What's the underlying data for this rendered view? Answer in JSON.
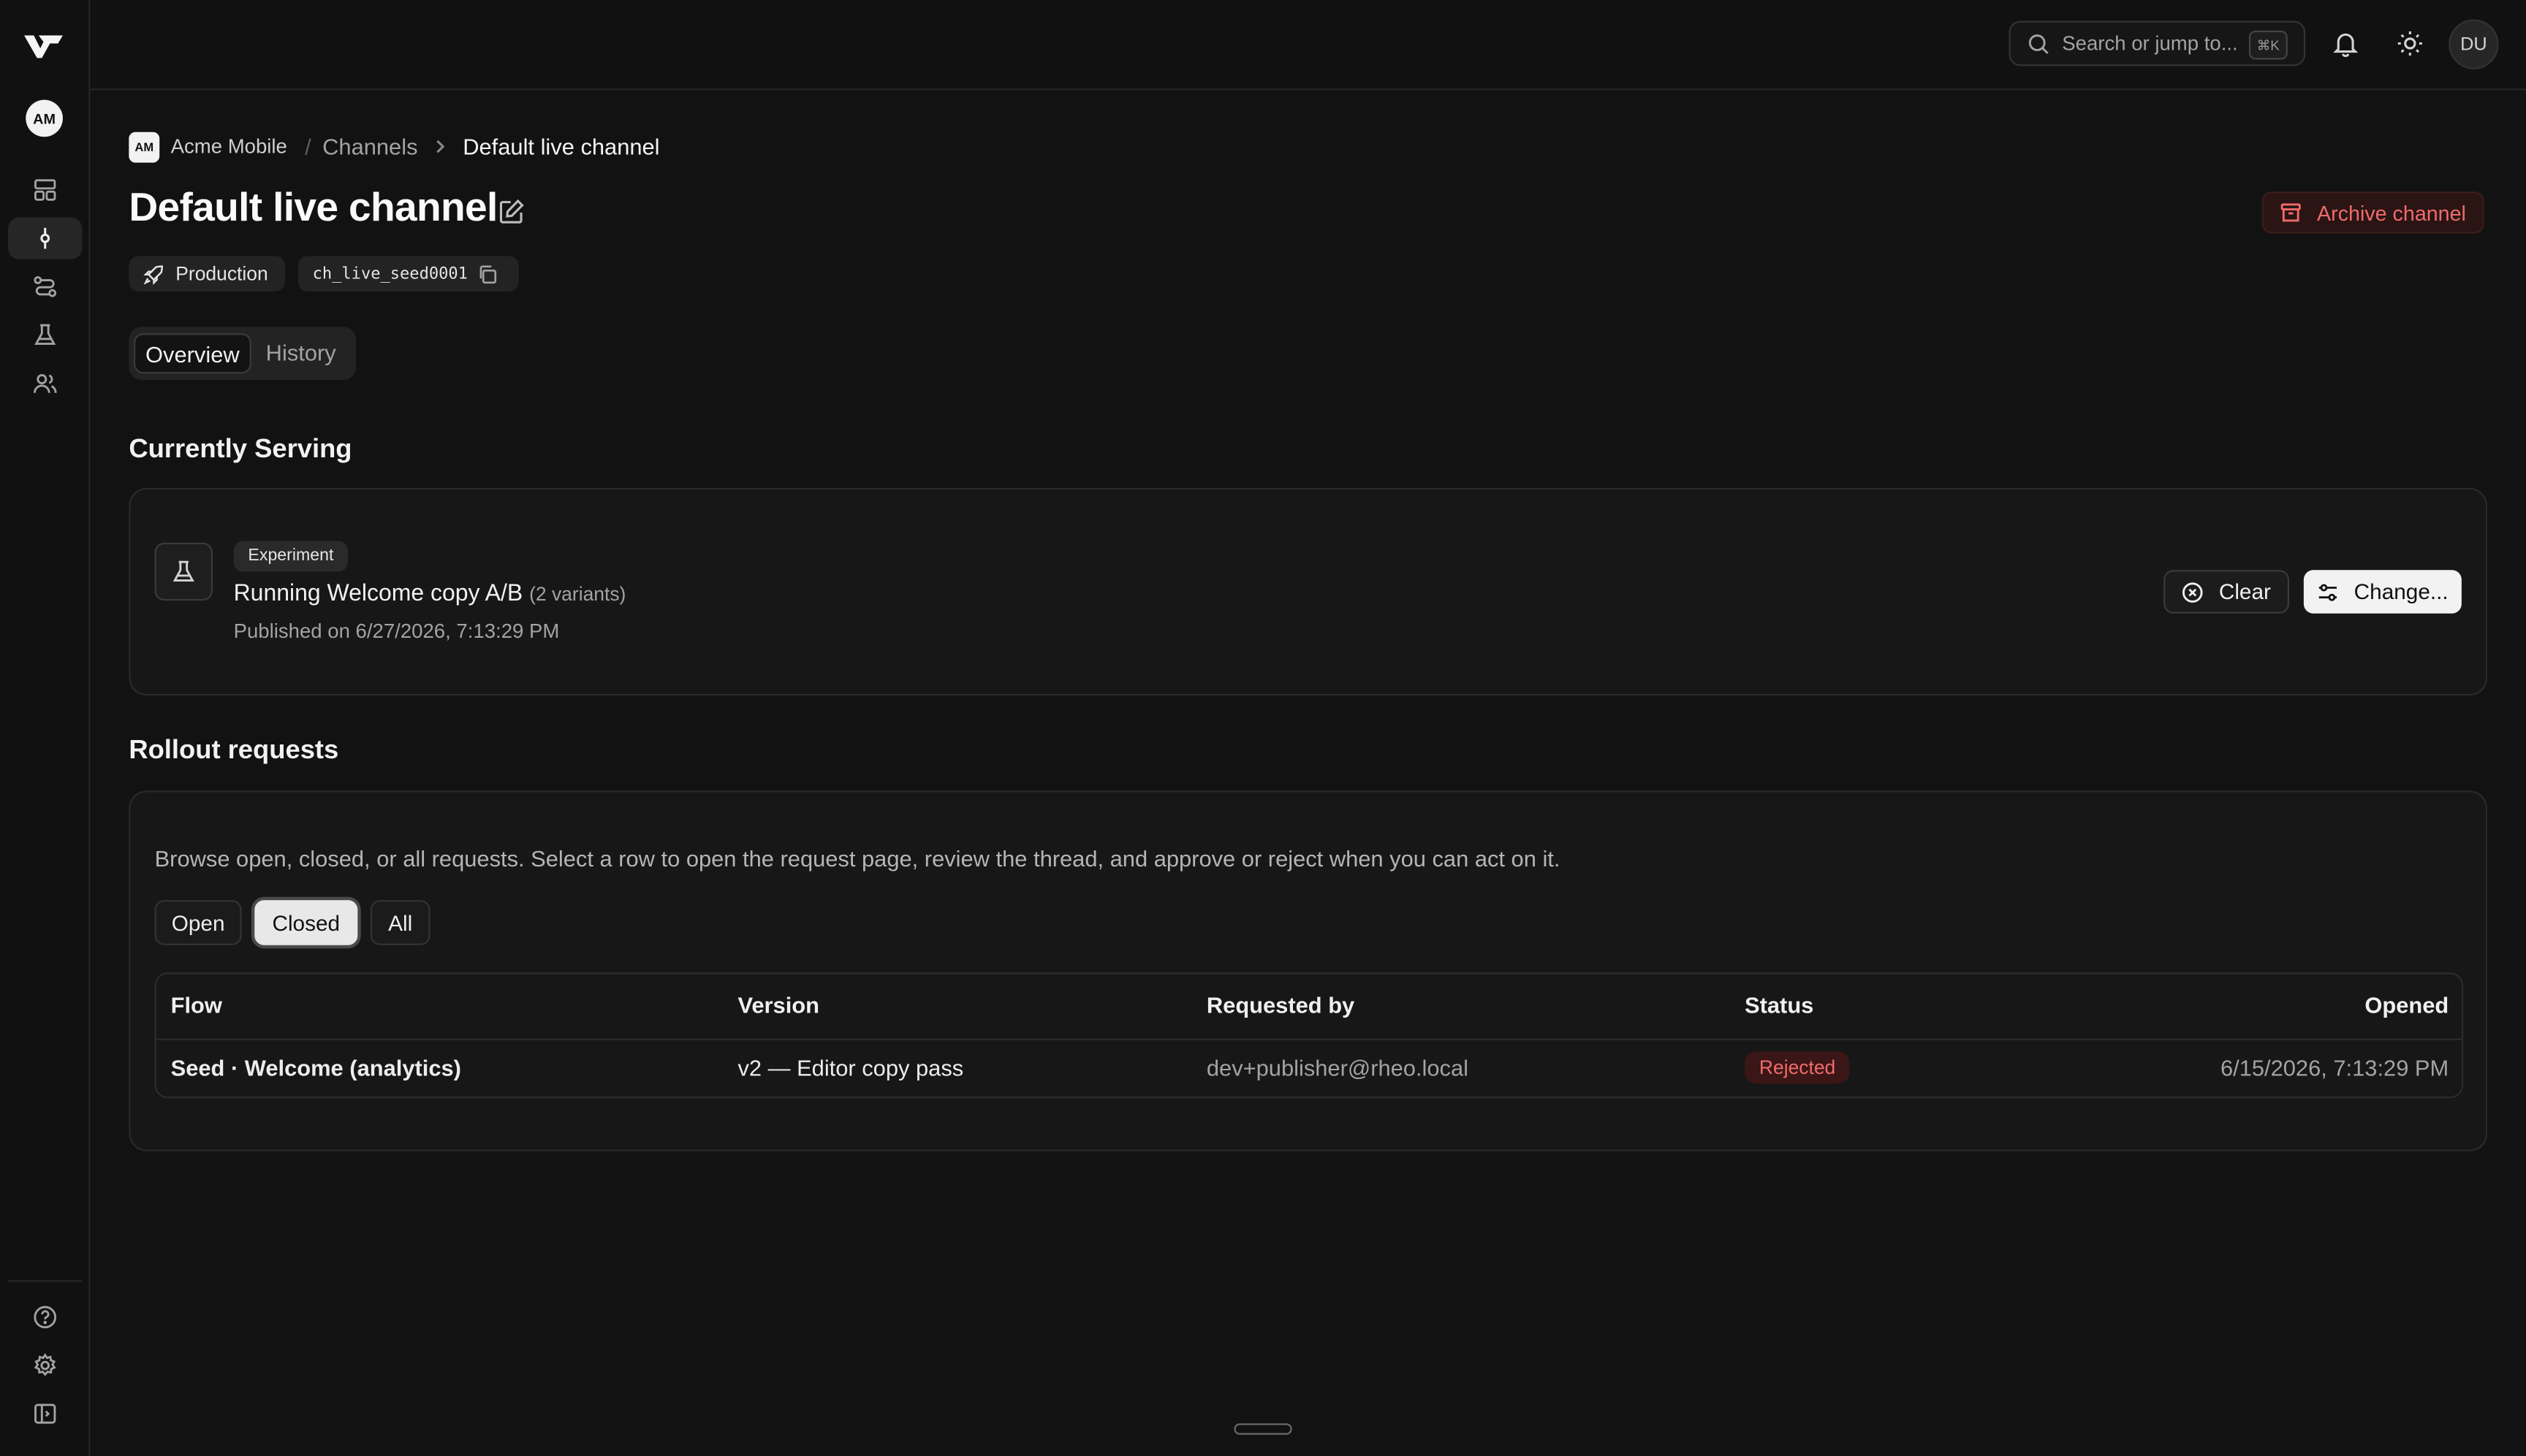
{
  "sidebar": {
    "org_initials": "AM",
    "nav_items": [
      {
        "name": "dashboard",
        "icon": "layout-dashboard-icon"
      },
      {
        "name": "channels",
        "icon": "git-commit-icon"
      },
      {
        "name": "flows",
        "icon": "route-icon"
      },
      {
        "name": "experiments",
        "icon": "flask-icon"
      },
      {
        "name": "members",
        "icon": "users-icon"
      }
    ],
    "footer_items": [
      {
        "name": "help",
        "icon": "help-circle-icon"
      },
      {
        "name": "settings",
        "icon": "gear-icon"
      },
      {
        "name": "collapse-sidebar",
        "icon": "panel-left-icon"
      }
    ]
  },
  "topbar": {
    "search_placeholder": "Search or jump to...",
    "search_shortcut": "⌘K",
    "user_initials": "DU"
  },
  "breadcrumb": {
    "org_initials": "AM",
    "org_name": "Acme Mobile",
    "separator": "/",
    "section": "Channels",
    "current": "Default live channel"
  },
  "page": {
    "title": "Default live channel",
    "archive_label": "Archive channel",
    "environment": "Production",
    "channel_id": "ch_live_seed0001",
    "tabs": [
      "Overview",
      "History"
    ],
    "active_tab": "Overview"
  },
  "serving": {
    "heading": "Currently Serving",
    "badge": "Experiment",
    "prefix": "Running",
    "name": "Welcome copy A/B",
    "variants": "(2 variants)",
    "published": "Published on 6/27/2026, 7:13:29 PM",
    "clear_label": "Clear",
    "change_label": "Change..."
  },
  "rollout": {
    "heading": "Rollout requests",
    "description": "Browse open, closed, or all requests. Select a row to open the request page, review the thread, and approve or reject when you can act on it.",
    "filters": [
      "Open",
      "Closed",
      "All"
    ],
    "active_filter": "Closed",
    "columns": [
      "Flow",
      "Version",
      "Requested by",
      "Status",
      "Opened"
    ],
    "rows": [
      {
        "flow": "Seed · Welcome (analytics)",
        "version": "v2 — Editor copy pass",
        "requested_by": "dev+publisher@rheo.local",
        "status": "Rejected",
        "opened": "6/15/2026, 7:13:29 PM"
      }
    ]
  },
  "colors": {
    "background": "#121212",
    "danger": "#ef6b6b",
    "danger_bg": "#3a1616",
    "primary_button": "#f2f2f2"
  }
}
